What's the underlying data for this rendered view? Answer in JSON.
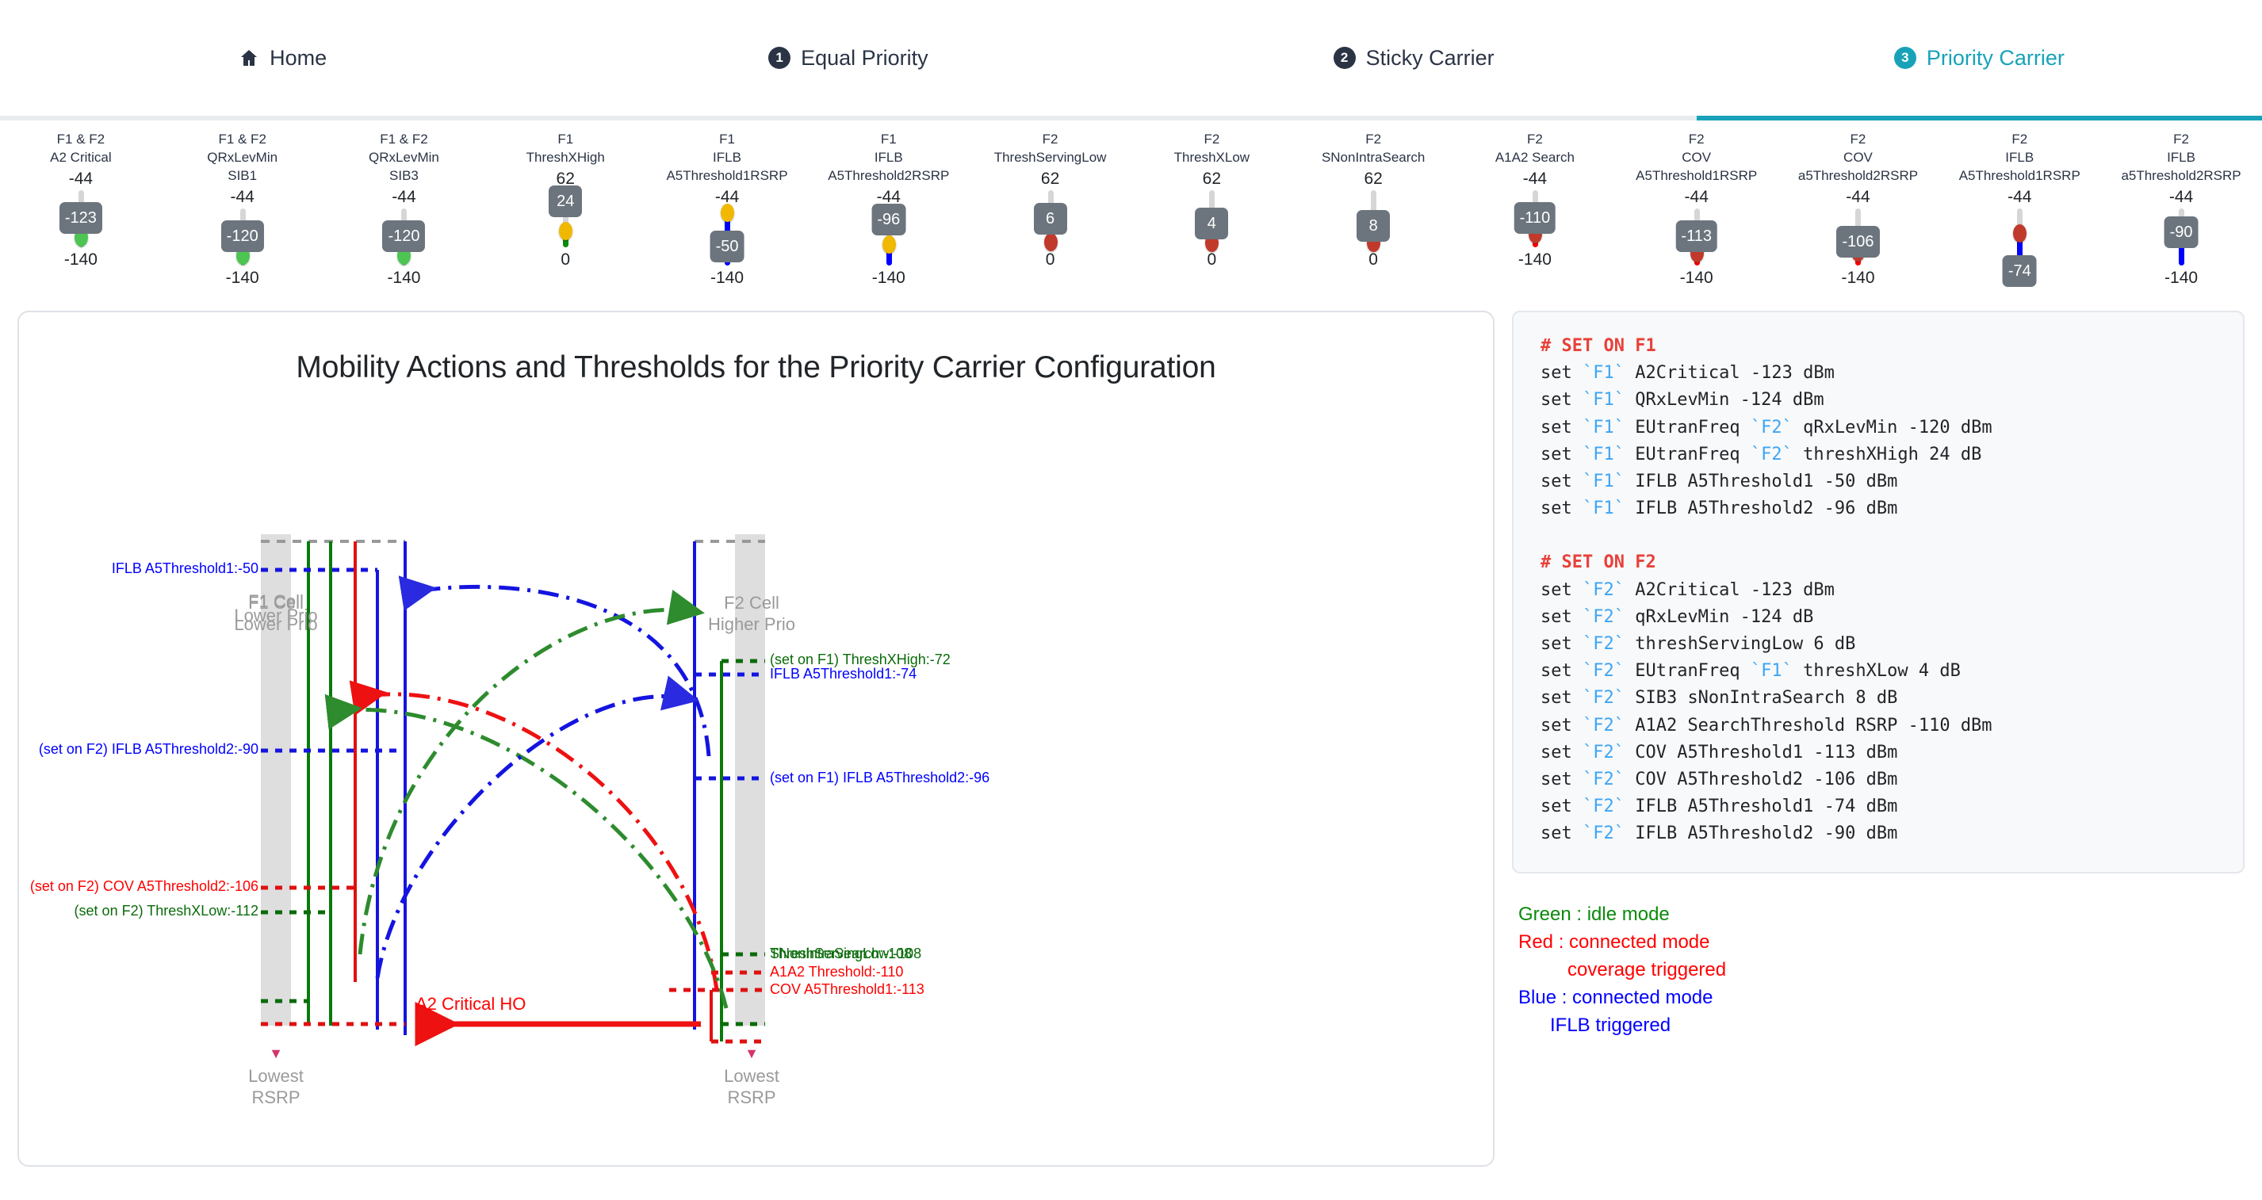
{
  "nav": {
    "tabs": [
      {
        "label": "Home",
        "icon": "home-icon",
        "badge": null,
        "active": false
      },
      {
        "label": "Equal Priority",
        "icon": "number-badge",
        "badge": "1",
        "active": false
      },
      {
        "label": "Sticky Carrier",
        "icon": "number-badge",
        "badge": "2",
        "active": false
      },
      {
        "label": "Priority Carrier",
        "icon": "number-badge",
        "badge": "3",
        "active": true
      }
    ],
    "accent_color": "#17a2b8"
  },
  "sliders": [
    {
      "carrier": "F1 & F2",
      "name": "A2 Critical",
      "sub": "",
      "max": "-44",
      "min": "-140",
      "value": "-123",
      "knob_color": "#4cc552",
      "fill_color": "#7ed67e",
      "fill_pct": 12,
      "tip_pct": 52
    },
    {
      "carrier": "F1 & F2",
      "name": "QRxLevMin",
      "sub": "SIB1",
      "max": "-44",
      "min": "-140",
      "value": "-120",
      "knob_color": "#4cc552",
      "fill_color": "#7ed67e",
      "fill_pct": 12,
      "tip_pct": 52
    },
    {
      "carrier": "F1 & F2",
      "name": "QRxLevMin",
      "sub": "SIB3",
      "max": "-44",
      "min": "-140",
      "value": "-120",
      "knob_color": "#4cc552",
      "fill_color": "#7ed67e",
      "fill_pct": 12,
      "tip_pct": 52
    },
    {
      "carrier": "F1",
      "name": "ThreshXHigh",
      "sub": "",
      "max": "62",
      "min": "0",
      "value": "24",
      "knob_color": "#f0b800",
      "fill_color": "#0a8a0a",
      "fill_pct": 24,
      "tip_pct": 80
    },
    {
      "carrier": "F1",
      "name": "IFLB",
      "sub": "A5Threshold1RSRP",
      "max": "-44",
      "min": "-140",
      "value": "-50",
      "knob_color": "#f0b800",
      "fill_color": "#0000ff",
      "fill_pct": 88,
      "tip_pct": 34
    },
    {
      "carrier": "F1",
      "name": "IFLB",
      "sub": "A5Threshold2RSRP",
      "max": "-44",
      "min": "-140",
      "value": "-96",
      "knob_color": "#f0b800",
      "fill_color": "#0000ff",
      "fill_pct": 32,
      "tip_pct": 80
    },
    {
      "carrier": "F2",
      "name": "ThreshServingLow",
      "sub": "",
      "max": "62",
      "min": "0",
      "value": "6",
      "knob_color": "#c0392b",
      "fill_color": "#c0392b",
      "fill_pct": 4,
      "tip_pct": 50
    },
    {
      "carrier": "F2",
      "name": "ThreshXLow",
      "sub": "",
      "max": "62",
      "min": "0",
      "value": "4",
      "knob_color": "#c0392b",
      "fill_color": "#c0392b",
      "fill_pct": 3,
      "tip_pct": 42
    },
    {
      "carrier": "F2",
      "name": "SNonIntraSearch",
      "sub": "",
      "max": "62",
      "min": "0",
      "value": "8",
      "knob_color": "#c0392b",
      "fill_color": "#0a8a0a",
      "fill_pct": 3,
      "tip_pct": 38
    },
    {
      "carrier": "F2",
      "name": "A1A2 Search",
      "sub": "",
      "max": "-44",
      "min": "-140",
      "value": "-110",
      "knob_color": "#c0392b",
      "fill_color": "#ff0000",
      "fill_pct": 18,
      "tip_pct": 52
    },
    {
      "carrier": "F2",
      "name": "COV",
      "sub": "A5Threshold1RSRP",
      "max": "-44",
      "min": "-140",
      "value": "-113",
      "knob_color": "#c0392b",
      "fill_color": "#ff0000",
      "fill_pct": 16,
      "tip_pct": 52
    },
    {
      "carrier": "F2",
      "name": "COV",
      "sub": "a5Threshold2RSRP",
      "max": "-44",
      "min": "-140",
      "value": "-106",
      "knob_color": "#c0392b",
      "fill_color": "#ff0000",
      "fill_pct": 18,
      "tip_pct": 42
    },
    {
      "carrier": "F2",
      "name": "IFLB",
      "sub": "A5Threshold1RSRP",
      "max": "-44",
      "min": "-140",
      "value": "-74",
      "knob_color": "#c0392b",
      "fill_color": "#0000ff",
      "fill_pct": 52,
      "tip_pct": -10
    },
    {
      "carrier": "F2",
      "name": "IFLB",
      "sub": "a5Threshold2RSRP",
      "max": "-44",
      "min": "-140",
      "value": "-90",
      "knob_color": "#c0392b",
      "fill_color": "#0000ff",
      "fill_pct": 46,
      "tip_pct": 58
    }
  ],
  "diagram": {
    "title": "Mobility Actions and Thresholds for the Priority Carrier Configuration",
    "left_cell": {
      "line1": "F1 Cell",
      "line2": "Lower Prio",
      "foot1": "Lowest",
      "foot2": "RSRP"
    },
    "right_cell": {
      "line1": "F2 Cell",
      "line2": "Higher Prio",
      "foot1": "Lowest",
      "foot2": "RSRP"
    },
    "center_label": "A2 Critical HO",
    "left_labels": [
      {
        "text": "IFLB A5Threshold1:-50",
        "color": "#0000ff"
      },
      {
        "text": "(set on F2) IFLB A5Threshold2:-90",
        "color": "#0000ff"
      },
      {
        "text": "(set on F2) COV A5Threshold2:-106",
        "color": "#ff0000"
      },
      {
        "text": "(set on F2) ThreshXLow:-112",
        "color": "#0a6b0a"
      }
    ],
    "right_labels": [
      {
        "text": "(set on F1) ThreshXHigh:-72",
        "color": "#0a6b0a"
      },
      {
        "text": "IFLB A5Threshold1:-74",
        "color": "#0000ff"
      },
      {
        "text": "(set on F1) IFLB A5Threshold2:-96",
        "color": "#0000ff"
      },
      {
        "text": "SNonIntraSearch:-108",
        "color": "#0a6b0a"
      },
      {
        "text": "ThreshServingLow:-108",
        "color": "#0a6b0a"
      },
      {
        "text": "A1A2 Threshold:-110",
        "color": "#ff0000"
      },
      {
        "text": "COV A5Threshold1:-113",
        "color": "#ff0000"
      }
    ]
  },
  "code": {
    "blocks": [
      {
        "comment": "# SET ON F1",
        "lines": [
          {
            "pre": "set ",
            "freq": "`F1`",
            "post": " A2Critical -123 dBm"
          },
          {
            "pre": "set ",
            "freq": "`F1`",
            "post": " QRxLevMin -124 dBm"
          },
          {
            "pre": "set ",
            "freq": "`F1`",
            "post": " EUtranFreq ",
            "freq2": "`F2`",
            "post2": " qRxLevMin -120 dBm"
          },
          {
            "pre": "set ",
            "freq": "`F1`",
            "post": " EUtranFreq ",
            "freq2": "`F2`",
            "post2": " threshXHigh 24 dB"
          },
          {
            "pre": "set ",
            "freq": "`F1`",
            "post": " IFLB A5Threshold1 -50 dBm"
          },
          {
            "pre": "set ",
            "freq": "`F1`",
            "post": " IFLB A5Threshold2 -96 dBm"
          }
        ]
      },
      {
        "comment": "# SET ON F2",
        "lines": [
          {
            "pre": "set ",
            "freq": "`F2`",
            "post": " A2Critical -123 dBm"
          },
          {
            "pre": "set ",
            "freq": "`F2`",
            "post": " qRxLevMin -124 dB"
          },
          {
            "pre": "set ",
            "freq": "`F2`",
            "post": " threshServingLow 6 dB"
          },
          {
            "pre": "set ",
            "freq": "`F2`",
            "post": " EUtranFreq ",
            "freq2": "`F1`",
            "post2": " threshXLow 4 dB"
          },
          {
            "pre": "set ",
            "freq": "`F2`",
            "post": " SIB3 sNonIntraSearch 8 dB"
          },
          {
            "pre": "set ",
            "freq": "`F2`",
            "post": " A1A2 SearchThreshold RSRP -110 dBm"
          },
          {
            "pre": "set ",
            "freq": "`F2`",
            "post": " COV A5Threshold1 -113 dBm"
          },
          {
            "pre": "set ",
            "freq": "`F2`",
            "post": " COV A5Threshold2 -106 dBm"
          },
          {
            "pre": "set ",
            "freq": "`F2`",
            "post": " IFLB A5Threshold1 -74 dBm"
          },
          {
            "pre": "set ",
            "freq": "`F2`",
            "post": " IFLB A5Threshold2 -90 dBm"
          }
        ]
      }
    ]
  },
  "legend": {
    "lines": [
      {
        "text": "Green : idle mode",
        "color": "#0a8a0a",
        "indent": 0
      },
      {
        "text": "Red : connected mode",
        "color": "#ff0000",
        "indent": 0
      },
      {
        "text": "coverage triggered",
        "color": "#ff0000",
        "indent": 62
      },
      {
        "text": "Blue : connected mode",
        "color": "#0000ff",
        "indent": 0
      },
      {
        "text": "IFLB triggered",
        "color": "#0000ff",
        "indent": 40
      }
    ]
  }
}
